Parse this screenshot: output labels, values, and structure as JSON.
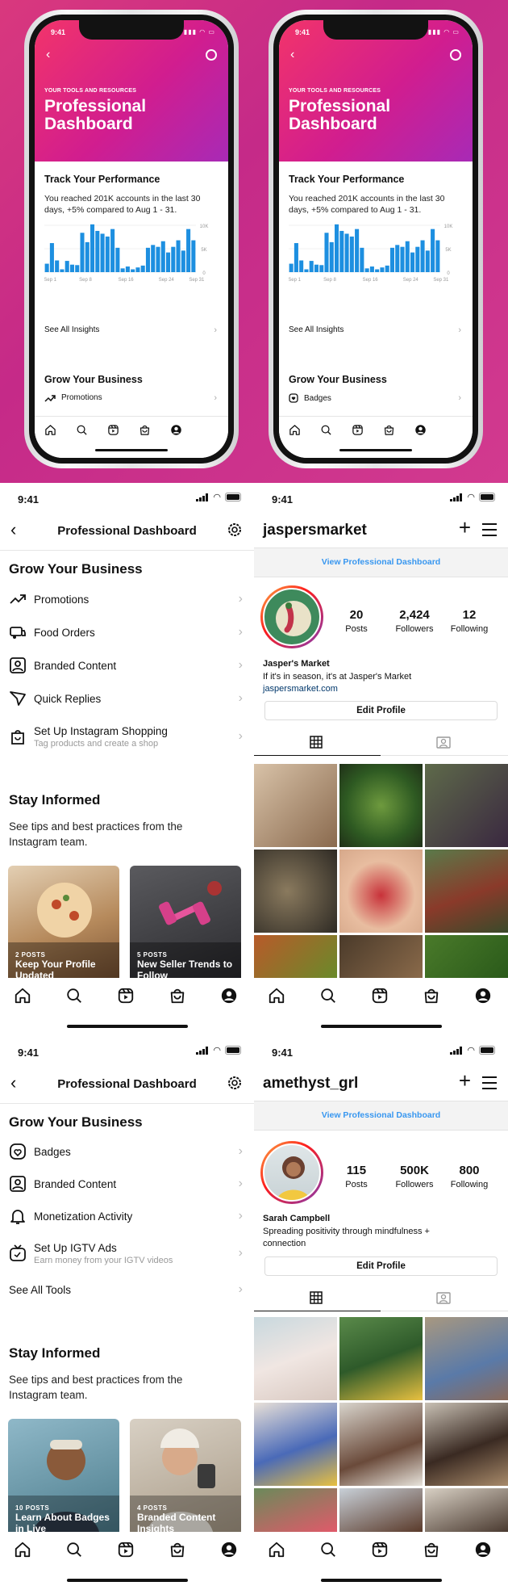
{
  "mockups": [
    {
      "time": "9:41",
      "kicker": "YOUR TOOLS AND RESOURCES",
      "title": "Professional Dashboard",
      "track_title": "Track Your Performance",
      "track_body": "You reached 201K accounts in the last 30 days, +5% compared to Aug 1 - 31.",
      "y_ticks": [
        "10K",
        "5K",
        "0"
      ],
      "x_ticks": [
        "Sep 1",
        "Sep 8",
        "Sep 16",
        "Sep 24",
        "Sep 31"
      ],
      "see_all": "See All Insights",
      "grow_title": "Grow Your Business",
      "grow_item": "Promotions",
      "grow_icon": "trending-up-icon"
    },
    {
      "time": "9:41",
      "kicker": "YOUR TOOLS AND RESOURCES",
      "title": "Professional Dashboard",
      "track_title": "Track Your Performance",
      "track_body": "You reached 201K accounts in the last 30 days, +5% compared to Aug 1 - 31.",
      "y_ticks": [
        "10K",
        "5K",
        "0"
      ],
      "x_ticks": [
        "Sep 1",
        "Sep 8",
        "Sep 16",
        "Sep 24",
        "Sep 31"
      ],
      "see_all": "See All Insights",
      "grow_title": "Grow Your Business",
      "grow_item": "Badges",
      "grow_icon": "badge-icon"
    }
  ],
  "chart_data": {
    "type": "bar",
    "x": [
      1,
      2,
      3,
      4,
      5,
      6,
      7,
      8,
      9,
      10,
      11,
      12,
      13,
      14,
      15,
      16,
      17,
      18,
      19,
      20,
      21,
      22,
      23,
      24,
      25,
      26,
      27,
      28,
      29,
      30
    ],
    "values": [
      1.8,
      6.2,
      2.5,
      0.6,
      2.4,
      1.6,
      1.5,
      8.4,
      6.4,
      10.2,
      8.8,
      8.2,
      7.6,
      9.2,
      5.2,
      0.8,
      1.2,
      0.6,
      1.0,
      1.4,
      5.2,
      5.8,
      5.4,
      6.6,
      4.2,
      5.4,
      6.8,
      4.6,
      9.2,
      6.8
    ],
    "ylim": [
      0,
      10
    ],
    "color": "#1d8fe0"
  },
  "dash1": {
    "time": "9:41",
    "title": "Professional Dashboard",
    "grow_title": "Grow Your Business",
    "items": [
      {
        "label": "Promotions",
        "icon": "trending-up-icon"
      },
      {
        "label": "Food Orders",
        "icon": "food-orders-icon"
      },
      {
        "label": "Branded Content",
        "icon": "branded-content-icon"
      },
      {
        "label": "Quick Replies",
        "icon": "quick-replies-icon"
      },
      {
        "label": "Set Up Instagram Shopping",
        "sub": "Tag products and create a shop",
        "icon": "shopping-bag-icon"
      }
    ],
    "stay_title": "Stay Informed",
    "stay_body": "See tips and best practices from the Instagram team.",
    "cards": [
      {
        "posts": "2 POSTS",
        "title": "Keep Your Profile Updated"
      },
      {
        "posts": "5 POSTS",
        "title": "New Seller Trends to Follow"
      }
    ]
  },
  "dash2": {
    "time": "9:41",
    "title": "Professional Dashboard",
    "grow_title": "Grow Your Business",
    "items": [
      {
        "label": "Badges",
        "icon": "badge-icon"
      },
      {
        "label": "Branded Content",
        "icon": "branded-content-icon"
      },
      {
        "label": "Monetization Activity",
        "icon": "bell-icon"
      },
      {
        "label": "Set Up IGTV Ads",
        "sub": "Earn money from your IGTV videos",
        "icon": "igtv-icon"
      }
    ],
    "see_all_tools": "See All Tools",
    "stay_title": "Stay Informed",
    "stay_body": "See tips and best practices from the Instagram team.",
    "cards": [
      {
        "posts": "10 POSTS",
        "title": "Learn About Badges in Live"
      },
      {
        "posts": "4 POSTS",
        "title": "Branded Content Insights"
      }
    ]
  },
  "profile1": {
    "time": "9:41",
    "username": "jaspersmarket",
    "view_dashboard": "View Professional Dashboard",
    "posts": "20",
    "posts_label": "Posts",
    "followers": "2,424",
    "followers_label": "Followers",
    "following": "12",
    "following_label": "Following",
    "name": "Jasper's Market",
    "bio": "If it's in season, it's at Jasper's Market",
    "link": "jaspersmarket.com",
    "edit": "Edit Profile"
  },
  "profile2": {
    "time": "9:41",
    "username": "amethyst_grl",
    "view_dashboard": "View Professional Dashboard",
    "posts": "115",
    "posts_label": "Posts",
    "followers": "500K",
    "followers_label": "Followers",
    "following": "800",
    "following_label": "Following",
    "name": "Sarah Campbell",
    "bio": "Spreading positivity through mindfulness + connection",
    "edit": "Edit Profile"
  },
  "nav_icons": [
    "home-icon",
    "search-icon",
    "reels-icon",
    "shop-icon",
    "profile-icon"
  ],
  "colors": {
    "brand_pink": "#d9387e",
    "link_blue": "#3897f0",
    "bar_blue": "#1d8fe0"
  }
}
